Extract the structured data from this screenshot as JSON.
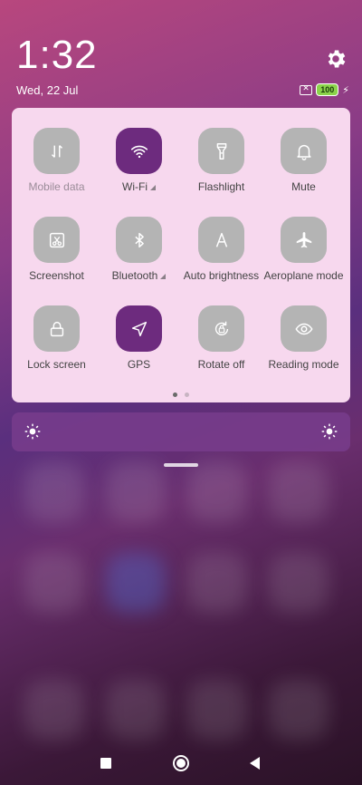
{
  "status": {
    "time": "1:32",
    "date": "Wed, 22 Jul",
    "battery": "100"
  },
  "tiles": [
    {
      "label": "Mobile data",
      "icon": "mobile-data-icon",
      "active": false,
      "dim": true
    },
    {
      "label": "Wi-Fi",
      "icon": "wifi-icon",
      "active": true,
      "expand": true
    },
    {
      "label": "Flashlight",
      "icon": "flashlight-icon",
      "active": false
    },
    {
      "label": "Mute",
      "icon": "bell-icon",
      "active": false
    },
    {
      "label": "Screenshot",
      "icon": "screenshot-icon",
      "active": false
    },
    {
      "label": "Bluetooth",
      "icon": "bluetooth-icon",
      "active": false,
      "expand": true
    },
    {
      "label": "Auto brightness",
      "icon": "auto-brightness-icon",
      "active": false
    },
    {
      "label": "Aeroplane mode",
      "icon": "airplane-icon",
      "active": false
    },
    {
      "label": "Lock screen",
      "icon": "lock-icon",
      "active": false
    },
    {
      "label": "GPS",
      "icon": "location-icon",
      "active": true
    },
    {
      "label": "Rotate off",
      "icon": "rotate-icon",
      "active": false
    },
    {
      "label": "Reading mode",
      "icon": "eye-icon",
      "active": false
    }
  ],
  "pager": {
    "pages": 2,
    "current": 1
  },
  "colors": {
    "tile_on": "#6d2b7e",
    "tile_off": "#b4b4b4",
    "panel": "#f7d8ee"
  }
}
